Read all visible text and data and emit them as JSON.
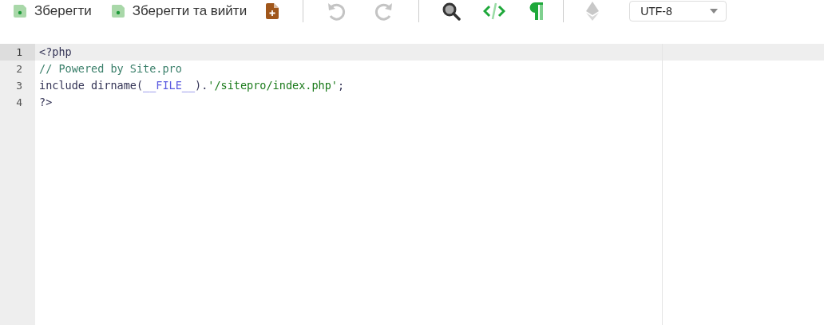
{
  "toolbar": [
    {
      "kind": "save",
      "label": "Зберегти",
      "disabled": false
    },
    {
      "kind": "save",
      "label": "Зберегти та вийти",
      "disabled": false
    },
    {
      "kind": "new-file",
      "disabled": false
    },
    {
      "kind": "separator"
    },
    {
      "kind": "undo",
      "disabled": true
    },
    {
      "kind": "redo",
      "disabled": true
    },
    {
      "kind": "separator"
    },
    {
      "kind": "search",
      "disabled": false
    },
    {
      "kind": "code",
      "disabled": false
    },
    {
      "kind": "pilcrow",
      "disabled": false
    },
    {
      "kind": "separator"
    },
    {
      "kind": "diamond",
      "disabled": true
    }
  ],
  "encoding": {
    "value": "UTF-8"
  },
  "editor": {
    "lines": [
      {
        "number": "1",
        "active": true,
        "tokens": [
          {
            "kind": "plain",
            "text": "<?php"
          }
        ]
      },
      {
        "number": "2",
        "active": false,
        "tokens": [
          {
            "kind": "comment",
            "text": "// Powered by Site.pro"
          }
        ]
      },
      {
        "number": "3",
        "active": false,
        "tokens": [
          {
            "kind": "plain",
            "text": "include dirname("
          },
          {
            "kind": "constant",
            "text": "__FILE__"
          },
          {
            "kind": "plain",
            "text": ")."
          },
          {
            "kind": "string",
            "text": "'/sitepro/index.php'"
          },
          {
            "kind": "plain",
            "text": ";"
          }
        ]
      },
      {
        "number": "4",
        "active": false,
        "tokens": [
          {
            "kind": "plain",
            "text": "?>"
          }
        ]
      }
    ]
  }
}
